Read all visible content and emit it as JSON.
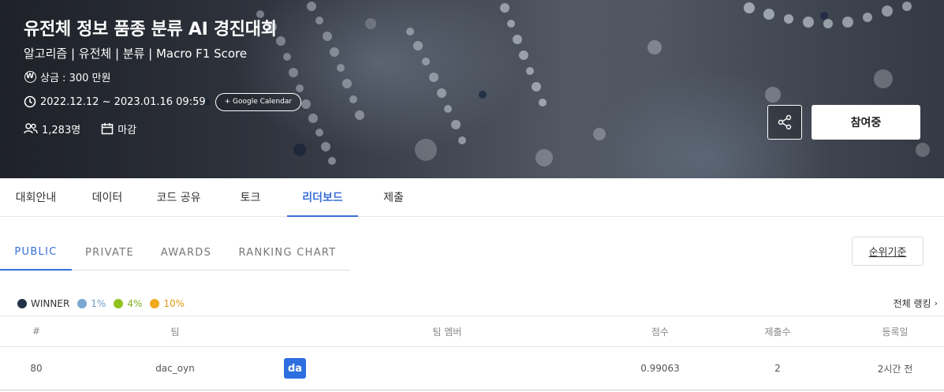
{
  "hero": {
    "title": "유전체 정보 품종 분류 AI 경진대회",
    "tags": "알고리즘 | 유전체 | 분류 | Macro F1 Score",
    "prize_symbol": "W",
    "prize": "상금 : 300 만원",
    "period": "2022.12.12 ~ 2023.01.16 09:59",
    "google_calendar_label": "+ Google Calendar",
    "participants": "1,283명",
    "status": "마감",
    "join_label": "참여중"
  },
  "main_tabs": [
    {
      "label": "대회안내"
    },
    {
      "label": "데이터"
    },
    {
      "label": "코드 공유"
    },
    {
      "label": "토크"
    },
    {
      "label": "리더보드",
      "active": true
    },
    {
      "label": "제출"
    }
  ],
  "sub_tabs": [
    {
      "label": "PUBLIC",
      "active": true
    },
    {
      "label": "PRIVATE"
    },
    {
      "label": "AWARDS"
    },
    {
      "label": "RANKING CHART"
    }
  ],
  "rank_basis_label": "순위기준",
  "legend": [
    {
      "label": "WINNER",
      "color": "#233246",
      "text_color": "#333333"
    },
    {
      "label": "1%",
      "color": "#7aa7cf",
      "text_color": "#6a9cc9"
    },
    {
      "label": "4%",
      "color": "#8fc31f",
      "text_color": "#7fb21a"
    },
    {
      "label": "10%",
      "color": "#f0a81c",
      "text_color": "#e29a10"
    }
  ],
  "full_ranking_label": "전체 랭킹",
  "table": {
    "headers": {
      "rank": "#",
      "team": "팀",
      "members": "팀 멤버",
      "score": "점수",
      "submissions": "제출수",
      "registered": "등록일"
    },
    "rows": [
      {
        "rank": "80",
        "team": "dac_oyn",
        "member_badge": "da",
        "score": "0.99063",
        "submissions": "2",
        "registered": "2시간 전"
      }
    ]
  },
  "colors": {
    "accent": "#3a6fd8",
    "badge": "#2d6fe0"
  }
}
